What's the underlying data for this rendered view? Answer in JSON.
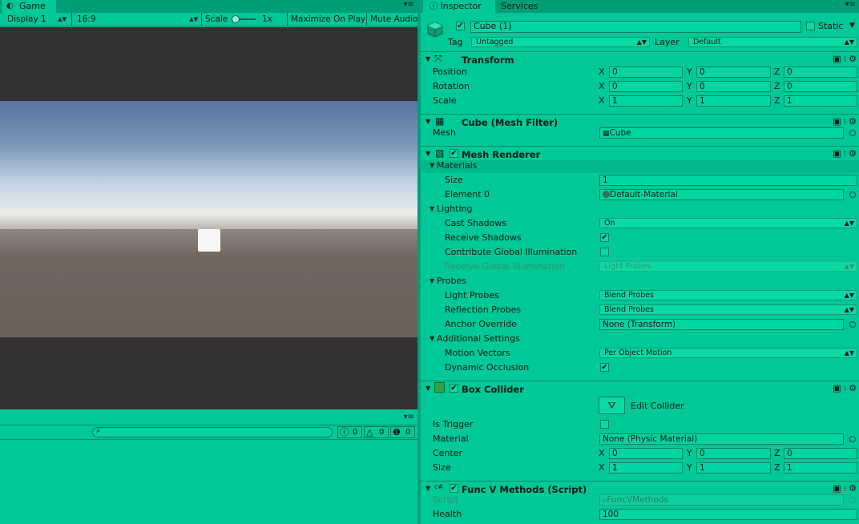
{
  "game": {
    "tab_label": "Game",
    "display_label": "Display 1",
    "aspect_label": "16:9",
    "scale_label": "Scale",
    "scale_value": "1x",
    "maximize_label": "Maximize On Play",
    "mute_label": "Mute Audio"
  },
  "console": {
    "search_placeholder": "",
    "error_count": "0",
    "warning_count": "0",
    "info_count": "0"
  },
  "inspector": {
    "tab_label": "Inspector",
    "services_tab_label": "Services",
    "object_name": "Cube (1)",
    "static_label": "Static",
    "tag_label": "Tag",
    "tag_value": "Untagged",
    "layer_label": "Layer",
    "layer_value": "Default"
  },
  "transform": {
    "title": "Transform",
    "rows": [
      {
        "label": "Position",
        "x": "0",
        "y": "0",
        "z": "0"
      },
      {
        "label": "Rotation",
        "x": "0",
        "y": "0",
        "z": "0"
      },
      {
        "label": "Scale",
        "x": "1",
        "y": "1",
        "z": "1"
      }
    ],
    "axis_x": "X",
    "axis_y": "Y",
    "axis_z": "Z"
  },
  "mesh_filter": {
    "title": "Cube (Mesh Filter)",
    "mesh_label": "Mesh",
    "mesh_value": "Cube"
  },
  "mesh_renderer": {
    "title": "Mesh Renderer",
    "materials_label": "Materials",
    "size_label": "Size",
    "size_value": "1",
    "element0_label": "Element 0",
    "element0_value": "Default-Material",
    "lighting_label": "Lighting",
    "cast_shadows_label": "Cast Shadows",
    "cast_shadows_value": "On",
    "receive_shadows_label": "Receive Shadows",
    "contribute_gi_label": "Contribute Global Illumination",
    "receive_gi_label": "Receive Global Illumination",
    "receive_gi_value": "Light Probes",
    "probes_label": "Probes",
    "light_probes_label": "Light Probes",
    "light_probes_value": "Blend Probes",
    "reflection_probes_label": "Reflection Probes",
    "reflection_probes_value": "Blend Probes",
    "anchor_override_label": "Anchor Override",
    "anchor_override_value": "None (Transform)",
    "additional_label": "Additional Settings",
    "motion_vectors_label": "Motion Vectors",
    "motion_vectors_value": "Per Object Motion",
    "dynamic_occlusion_label": "Dynamic Occlusion"
  },
  "box_collider": {
    "title": "Box Collider",
    "edit_collider_label": "Edit Collider",
    "is_trigger_label": "Is Trigger",
    "material_label": "Material",
    "material_value": "None (Physic Material)",
    "center_label": "Center",
    "center": {
      "x": "0",
      "y": "0",
      "z": "0"
    },
    "size_label": "Size",
    "size": {
      "x": "1",
      "y": "1",
      "z": "1"
    }
  },
  "script_component": {
    "title": "Func V Methods (Script)",
    "script_label": "Script",
    "script_value": "FuncVMethods",
    "health_label": "Health",
    "health_value": "100"
  },
  "colors": {
    "theme_green": "#00c896",
    "tab_strip": "#009e76",
    "sky_top": "#5775a0",
    "ground": "#6b5f56",
    "viewport_bg": "#333131"
  }
}
